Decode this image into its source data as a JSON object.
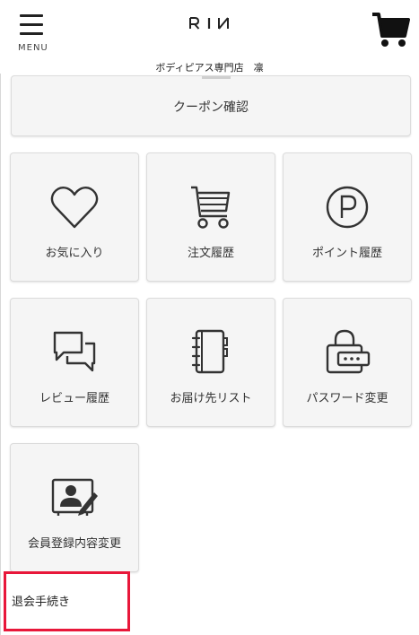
{
  "header": {
    "menu_label": "MENU",
    "logo_text": "RIИ",
    "shop_name": "ボディピアス専門店　凛",
    "menu_icon": "hamburger-menu-icon",
    "cart_icon": "shopping-cart-icon"
  },
  "coupon": {
    "label": "クーポン確認"
  },
  "tiles": [
    {
      "label": "お気に入り",
      "icon": "heart-icon"
    },
    {
      "label": "注文履歴",
      "icon": "cart-icon"
    },
    {
      "label": "ポイント履歴",
      "icon": "points-p-icon"
    },
    {
      "label": "レビュー履歴",
      "icon": "chat-bubbles-icon"
    },
    {
      "label": "お届け先リスト",
      "icon": "address-book-icon"
    },
    {
      "label": "パスワード変更",
      "icon": "padlock-password-icon"
    },
    {
      "label": "会員登録内容変更",
      "icon": "profile-edit-icon"
    }
  ],
  "withdraw": {
    "label": "退会手続き",
    "highlight_color": "#e8173a"
  }
}
